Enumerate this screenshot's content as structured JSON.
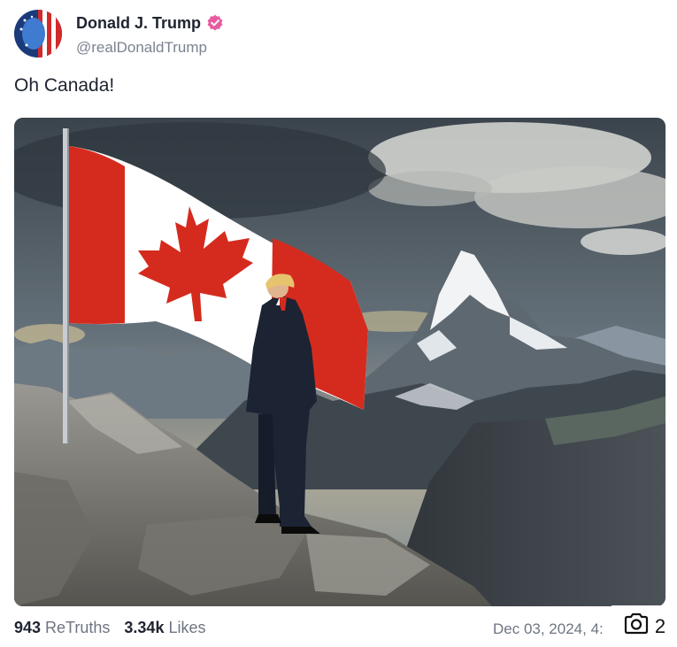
{
  "author": {
    "name": "Donald J. Trump",
    "handle": "@realDonaldTrump",
    "verified_color": "#e95aa0"
  },
  "post": {
    "text": "Oh Canada!"
  },
  "stats": {
    "retruths_count": "943",
    "retruths_label": "ReTruths",
    "likes_count": "3.34k",
    "likes_label": "Likes"
  },
  "timestamp": "Dec 03, 2024, 4:",
  "overlay": {
    "icon": "camera-icon",
    "count": "2"
  },
  "colors": {
    "flag_red": "#d52b1e",
    "text_primary": "#1f2330",
    "text_secondary": "#6e7582"
  }
}
